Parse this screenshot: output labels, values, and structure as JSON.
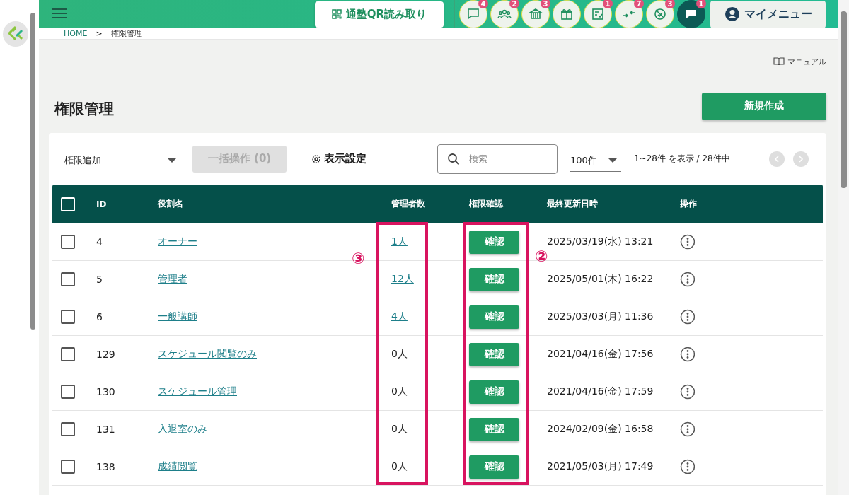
{
  "header": {
    "qr_button": "通塾QR読み取り",
    "icons": [
      {
        "badge": "4",
        "active": false
      },
      {
        "badge": "2",
        "active": false
      },
      {
        "badge": "3",
        "active": false
      },
      {
        "active": false
      },
      {
        "badge": "1",
        "active": false
      },
      {
        "badge": "7",
        "active": false
      },
      {
        "badge": "3",
        "active": false
      },
      {
        "badge": "1",
        "active": true
      }
    ],
    "my_menu": "マイメニュー"
  },
  "breadcrumb": [
    "HOME",
    "権限管理"
  ],
  "breadcrumb_separator": ">",
  "manual_link": "マニュアル",
  "page_title": "権限管理",
  "new_button": "新規作成",
  "toolbar": {
    "add_select": "権限追加",
    "bulk_button": "一括操作 (0)",
    "bulk_disabled": true,
    "display_settings": "表示設定",
    "search_placeholder": "検索",
    "per_page": "100件",
    "range": "1~28件 を表示 / 28件中"
  },
  "table": {
    "all_checked": false,
    "columns": [
      "ID",
      "役割名",
      "管理者数",
      "権限確認",
      "最終更新日時",
      "操作"
    ],
    "rows": [
      {
        "checked": false,
        "id": "4",
        "role": "オーナー",
        "count": "1人",
        "count_link": true,
        "confirm": "確認",
        "updated": "2025/03/19(水) 13:21"
      },
      {
        "checked": false,
        "id": "5",
        "role": "管理者",
        "count": "12人",
        "count_link": true,
        "confirm": "確認",
        "updated": "2025/05/01(木) 16:22"
      },
      {
        "checked": false,
        "id": "6",
        "role": "一般講師",
        "count": "4人",
        "count_link": true,
        "confirm": "確認",
        "updated": "2025/03/03(月) 11:36"
      },
      {
        "checked": false,
        "id": "129",
        "role": "スケジュール閲覧のみ",
        "count": "0人",
        "count_link": false,
        "confirm": "確認",
        "updated": "2021/04/16(金) 17:56"
      },
      {
        "checked": false,
        "id": "130",
        "role": "スケジュール管理",
        "count": "0人",
        "count_link": false,
        "confirm": "確認",
        "updated": "2021/04/16(金) 17:59"
      },
      {
        "checked": false,
        "id": "131",
        "role": "入退室のみ",
        "count": "0人",
        "count_link": false,
        "confirm": "確認",
        "updated": "2024/02/09(金) 16:58"
      },
      {
        "checked": false,
        "id": "138",
        "role": "成績閲覧",
        "count": "0人",
        "count_link": false,
        "confirm": "確認",
        "updated": "2021/05/03(月) 17:49"
      }
    ]
  },
  "annotations": [
    "③",
    "②"
  ]
}
